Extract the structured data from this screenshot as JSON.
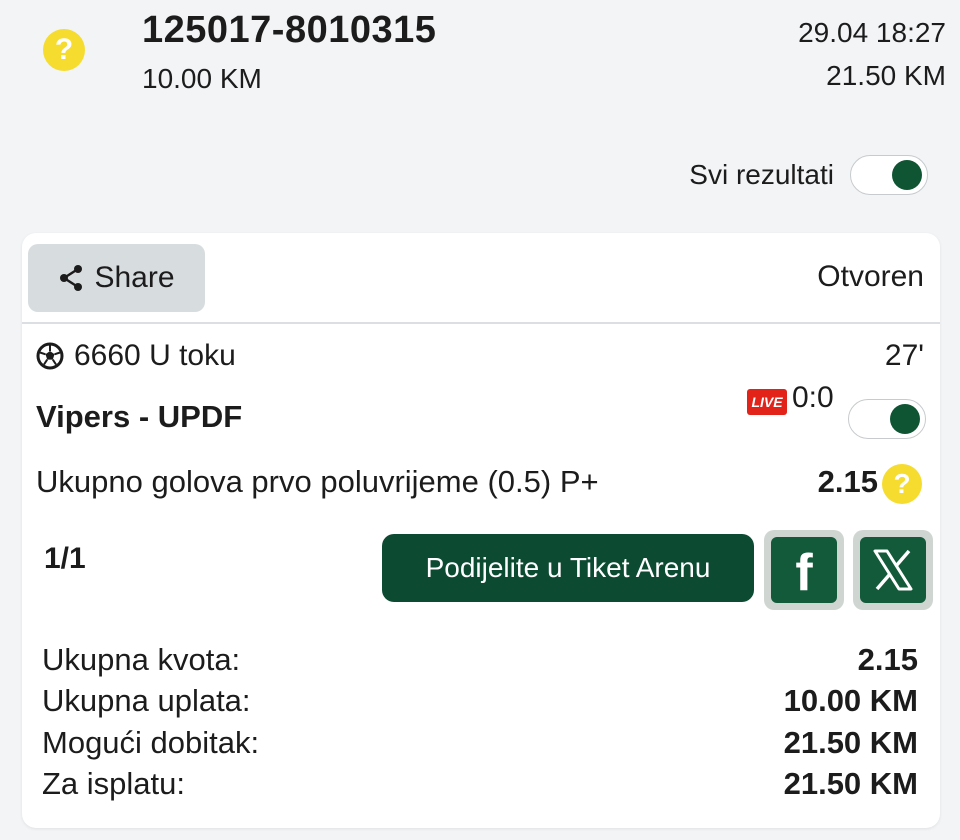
{
  "header": {
    "ticket_id": "125017-8010315",
    "stake": "10.00 KM",
    "datetime": "29.04 18:27",
    "payout": "21.50 KM",
    "status_icon": "?"
  },
  "filter": {
    "all_results_label": "Svi rezultati",
    "all_results_on": true
  },
  "card": {
    "share_label": "Share",
    "status": "Otvoren",
    "event": {
      "sport_icon": "soccer-ball-icon",
      "code_status": "6660 U toku",
      "minute": "27'",
      "match": "Vipers - UPDF",
      "live_badge": "LIVE",
      "score": "0:0",
      "live_toggle_on": true,
      "market": "Ukupno golova prvo poluvrijeme (0.5) P+",
      "odd": "2.15",
      "odd_help_icon": "?"
    },
    "page_count": "1/1",
    "arena_button": "Podijelite u Tiket Arenu",
    "facebook_label": "f",
    "summary": [
      {
        "label": "Ukupna kvota:",
        "value": "2.15"
      },
      {
        "label": "Ukupna uplata:",
        "value": "10.00 KM"
      },
      {
        "label": "Mogući dobitak:",
        "value": "21.50 KM"
      },
      {
        "label": "Za isplatu:",
        "value": "21.50 KM"
      }
    ]
  },
  "colors": {
    "accent_green": "#0c4a32",
    "warning_yellow": "#f5dc2e",
    "live_red": "#e2231a"
  }
}
